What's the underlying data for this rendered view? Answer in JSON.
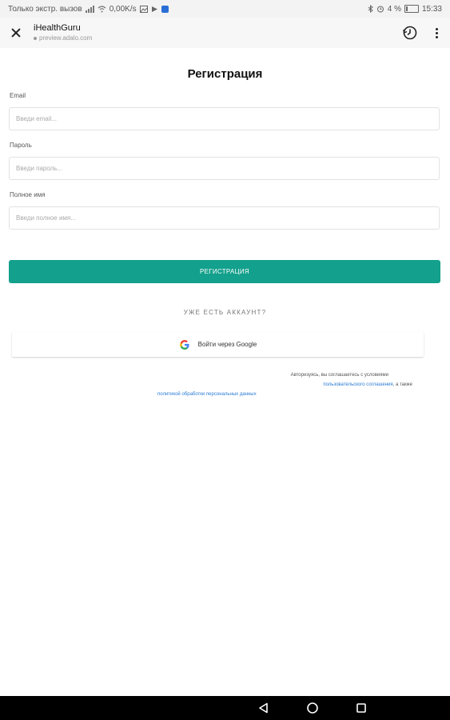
{
  "status_bar": {
    "carrier": "Только экстр. вызов",
    "speed": "0,00K/s",
    "battery": "4 %",
    "time": "15:33"
  },
  "browser": {
    "title": "iHealthGuru",
    "url": "preview.adalo.com"
  },
  "form": {
    "title": "Регистрация",
    "email_label": "Email",
    "email_placeholder": "Введи email...",
    "password_label": "Пароль",
    "password_placeholder": "Введи пароль...",
    "name_label": "Полное имя",
    "name_placeholder": "Введи полное имя...",
    "register_button": "РЕГИСТРАЦИЯ",
    "have_account": "УЖЕ ЕСТЬ АККАУНТ?",
    "google_button": "Войти через Google"
  },
  "terms": {
    "prefix": "Авторизуясь, вы соглашаетесь с условиями",
    "user_agreement_link": "пользовательского соглашения",
    "middle": ", а также",
    "privacy_link": "политикой обработки персональных данных"
  },
  "colors": {
    "accent": "#13a08c",
    "link": "#2a7bd4"
  }
}
